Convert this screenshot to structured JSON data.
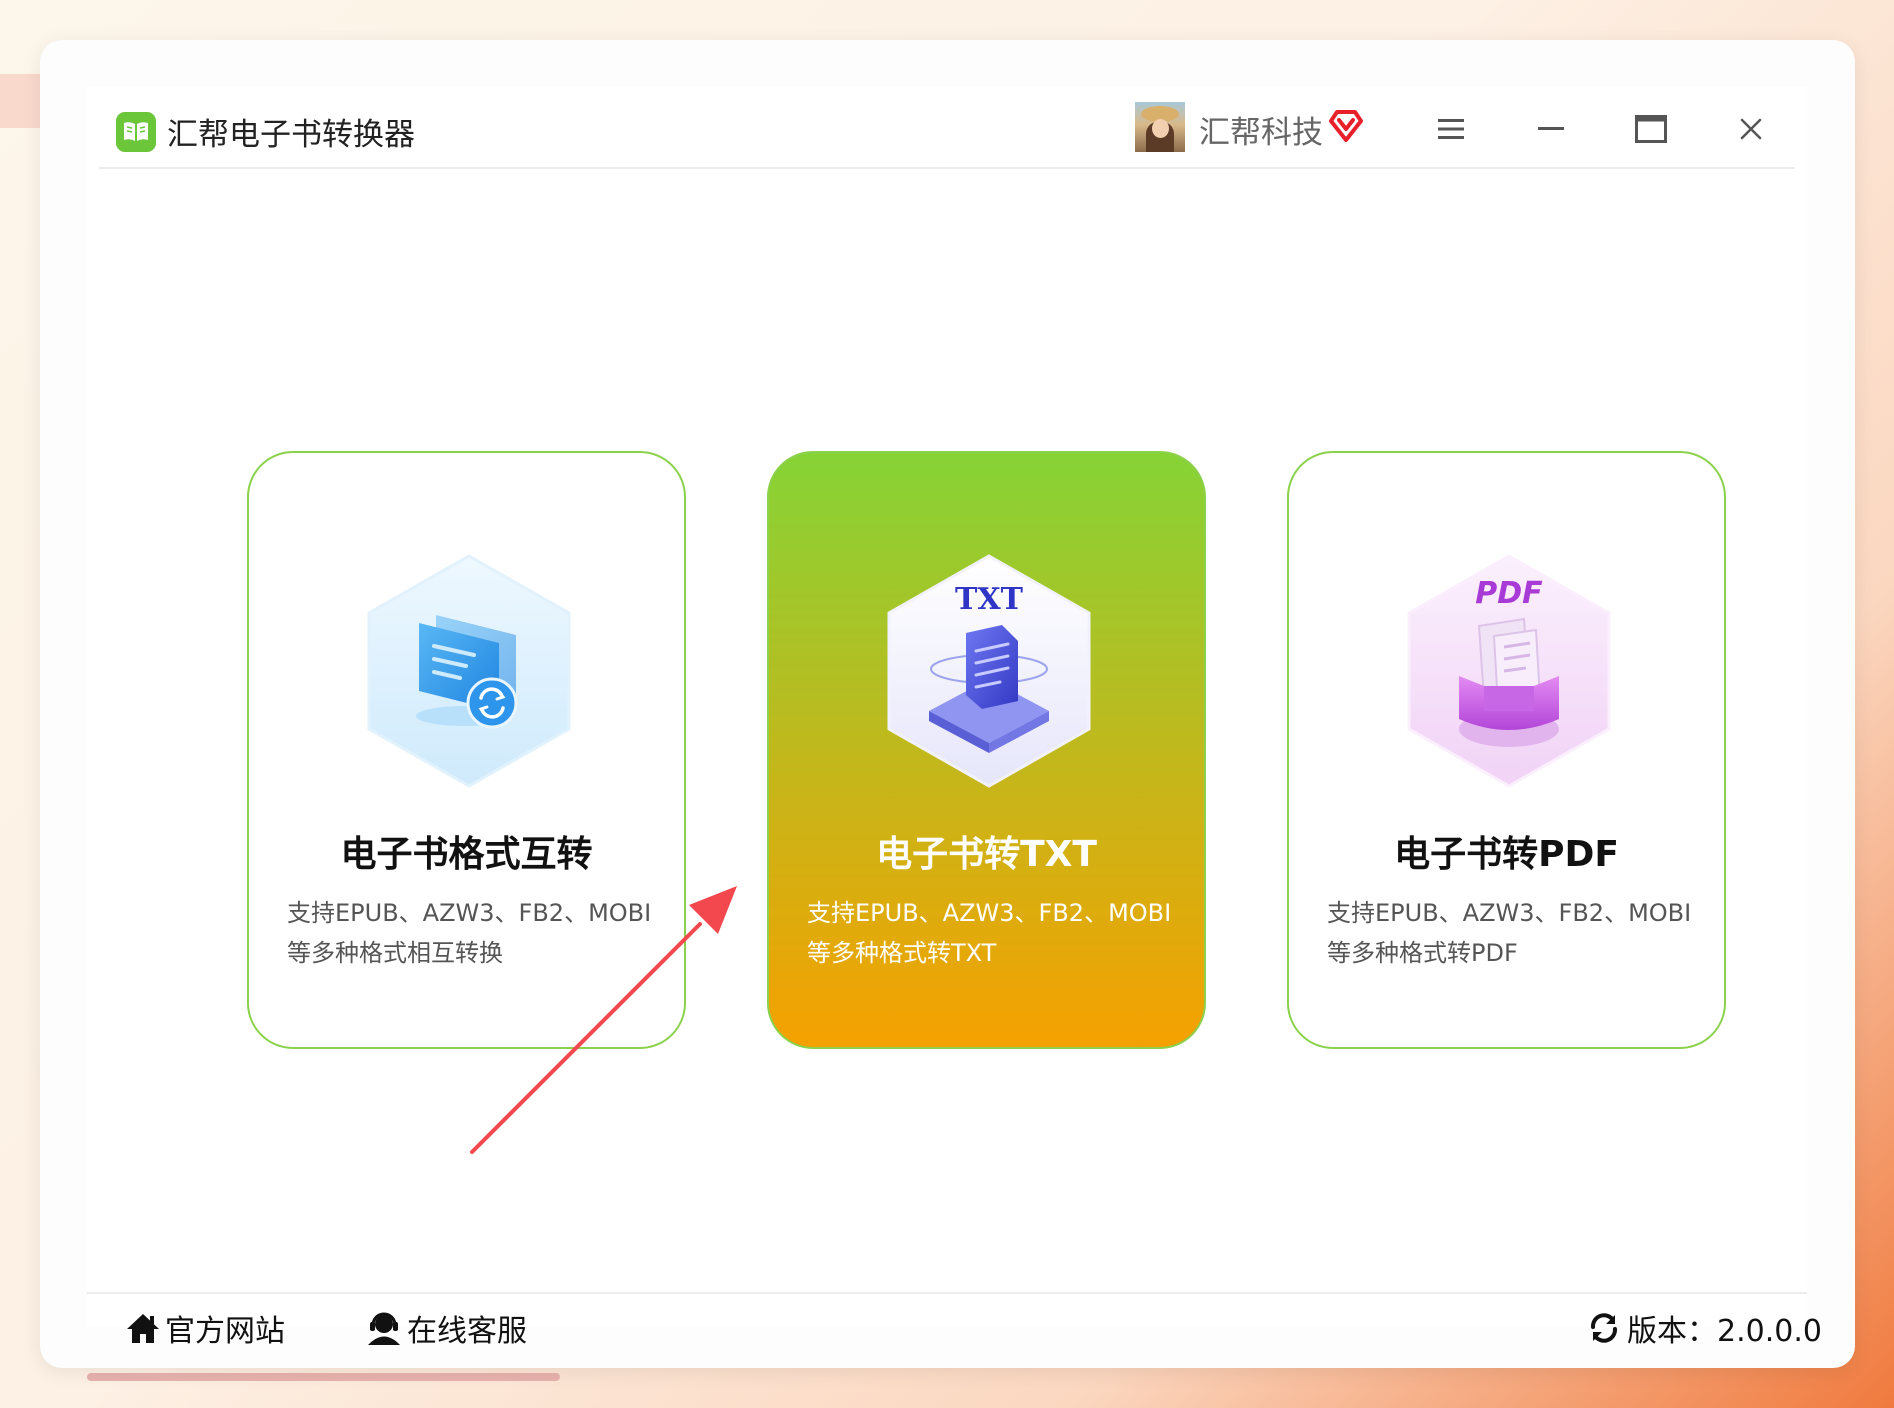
{
  "app": {
    "title": "汇帮电子书转换器",
    "company": "汇帮科技",
    "accent_color": "#8bd14b",
    "highlight_gradient": [
      "#86d336",
      "#f5a100"
    ]
  },
  "titlebar": {
    "icons": [
      "app-logo-icon",
      "vip-diamond-icon",
      "menu-icon",
      "minimize-icon",
      "maximize-icon",
      "close-icon"
    ]
  },
  "cards": [
    {
      "title": "电子书格式互转",
      "desc_line1": "支持EPUB、AZW3、FB2、MOBI",
      "desc_line2": "等多种格式相互转换",
      "icon": "format-convert-icon"
    },
    {
      "title": "电子书转TXT",
      "desc_line1": "支持EPUB、AZW3、FB2、MOBI",
      "desc_line2": "等多种格式转TXT",
      "icon_label": "TXT",
      "icon": "txt-convert-icon",
      "selected": true
    },
    {
      "title": "电子书转PDF",
      "desc_line1": "支持EPUB、AZW3、FB2、MOBI",
      "desc_line2": "等多种格式转PDF",
      "icon_label": "PDF",
      "icon": "pdf-convert-icon"
    }
  ],
  "footer": {
    "website_label": "官方网站",
    "service_label": "在线客服",
    "version_label": "版本：2.0.0.0"
  }
}
